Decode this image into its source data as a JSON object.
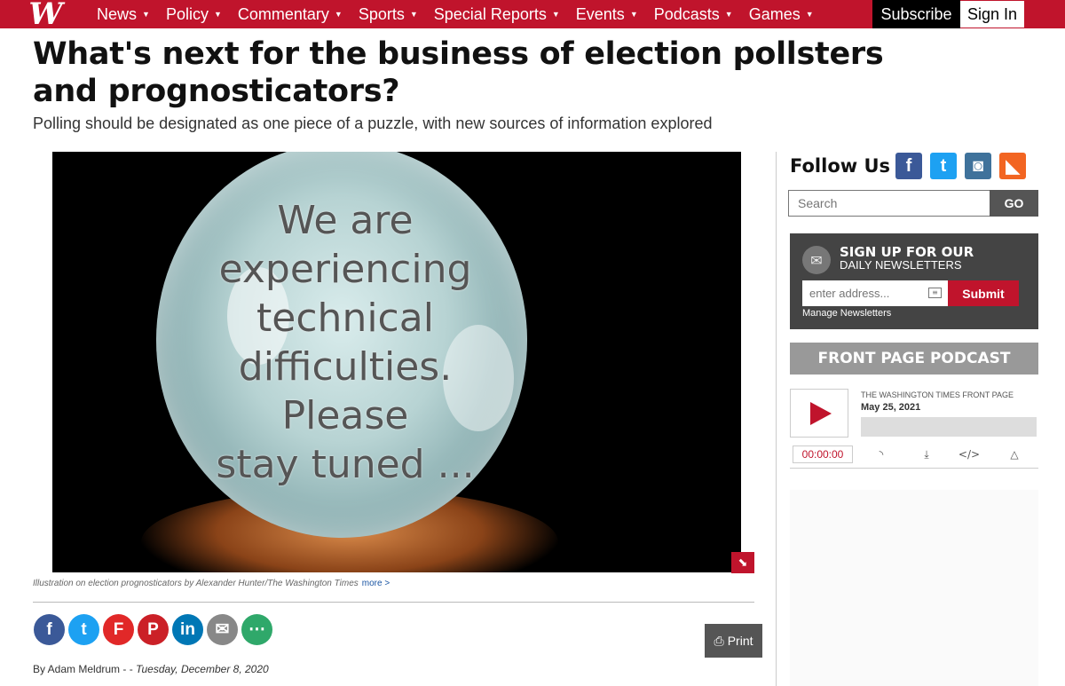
{
  "nav": {
    "logo": "W",
    "items": [
      {
        "label": "News"
      },
      {
        "label": "Policy"
      },
      {
        "label": "Commentary"
      },
      {
        "label": "Sports"
      },
      {
        "label": "Special Reports"
      },
      {
        "label": "Events"
      },
      {
        "label": "Podcasts"
      },
      {
        "label": "Games"
      }
    ],
    "subscribe": "Subscribe",
    "sign_in": "Sign In"
  },
  "article": {
    "headline": "What's next for the business of election pollsters and prognosticators?",
    "subhead": "Polling should be designated as one piece of a puzzle, with new sources of information explored",
    "image_text": "We are\nexperiencing\ntechnical\ndifficulties.\nPlease\nstay tuned ...",
    "caption": "Illustration on election prognosticators by Alexander Hunter/The Washington Times",
    "caption_more": "more >",
    "print": "Print",
    "byline_author": "By Adam Meldrum - -",
    "byline_date": "Tuesday, December 8, 2020",
    "share": [
      {
        "icon": "facebook-icon",
        "glyph": "f",
        "color": "#3b5998"
      },
      {
        "icon": "twitter-icon",
        "glyph": "t",
        "color": "#1da1f2"
      },
      {
        "icon": "flipboard-icon",
        "glyph": "F",
        "color": "#e12828"
      },
      {
        "icon": "pinterest-icon",
        "glyph": "P",
        "color": "#cb2027"
      },
      {
        "icon": "linkedin-icon",
        "glyph": "in",
        "color": "#0077b5"
      },
      {
        "icon": "email-icon",
        "glyph": "✉",
        "color": "#888888"
      },
      {
        "icon": "more-share-icon",
        "glyph": "⋯",
        "color": "#2fa86a"
      }
    ]
  },
  "sidebar": {
    "follow_label": "Follow Us",
    "social": [
      {
        "icon": "facebook-icon",
        "glyph": "f",
        "color": "#3b5998"
      },
      {
        "icon": "twitter-icon",
        "glyph": "t",
        "color": "#1da1f2"
      },
      {
        "icon": "instagram-icon",
        "glyph": "◙",
        "color": "#3f729b"
      },
      {
        "icon": "rss-icon",
        "glyph": "◣",
        "color": "#f26522"
      }
    ],
    "search_placeholder": "Search",
    "search_go": "GO",
    "newsletter": {
      "title1": "SIGN UP FOR OUR",
      "title2": "DAILY NEWSLETTERS",
      "placeholder": "enter address...",
      "submit": "Submit",
      "manage": "Manage Newsletters"
    },
    "podcast": {
      "heading": "FRONT PAGE PODCAST",
      "show": "THE WASHINGTON TIMES FRONT PAGE",
      "date": "May 25, 2021",
      "time": "00:00:00",
      "progress": 0
    }
  },
  "colors": {
    "brand_red": "#c0142c",
    "dark_panel": "#444444",
    "podcast_gray": "#999999"
  }
}
